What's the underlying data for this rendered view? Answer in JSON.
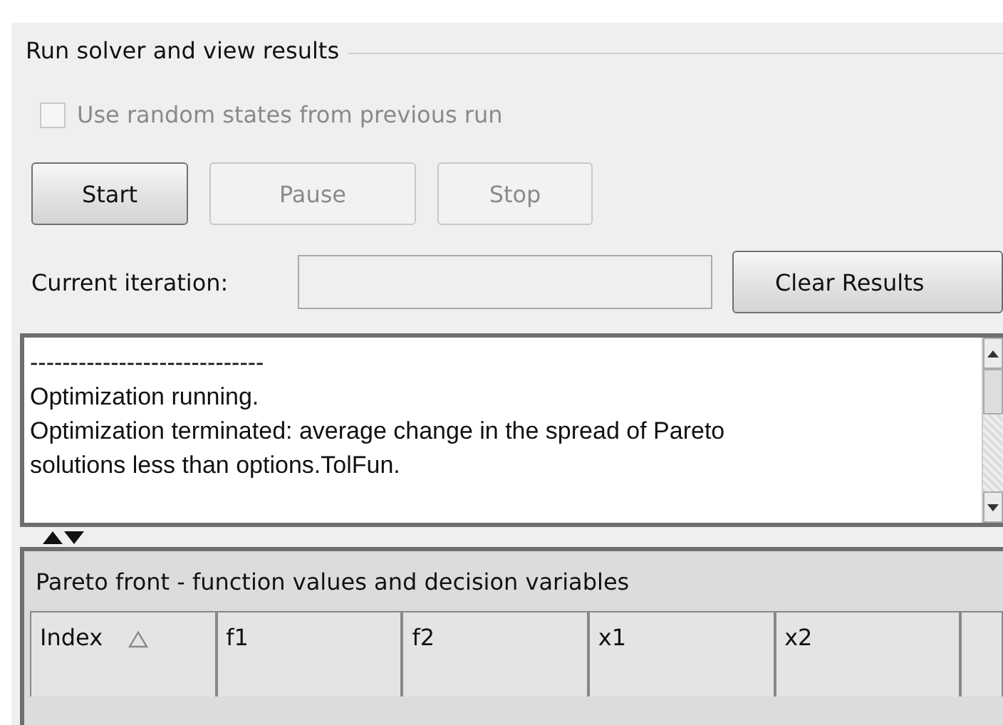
{
  "group": {
    "title": "Run solver and view results"
  },
  "random_states": {
    "label": "Use random states from previous run",
    "checked": false,
    "disabled": true
  },
  "buttons": [
    {
      "label": "Start",
      "disabled": false
    },
    {
      "label": "Pause",
      "disabled": true
    },
    {
      "label": "Stop",
      "disabled": true
    }
  ],
  "iteration": {
    "label": "Current iteration:"
  },
  "clear_button": {
    "label": "Clear Results"
  },
  "log": {
    "lines": [
      "-----------------------------",
      "Optimization running.",
      "Optimization terminated: average change in the spread of Pareto",
      "solutions less than options.TolFun."
    ]
  },
  "pareto": {
    "title": "Pareto front - function values and decision variables",
    "columns": [
      {
        "label": "Index",
        "sorted": true
      },
      {
        "label": "f1",
        "sorted": false
      },
      {
        "label": "f2",
        "sorted": false
      },
      {
        "label": "x1",
        "sorted": false
      },
      {
        "label": "x2",
        "sorted": false
      }
    ]
  }
}
